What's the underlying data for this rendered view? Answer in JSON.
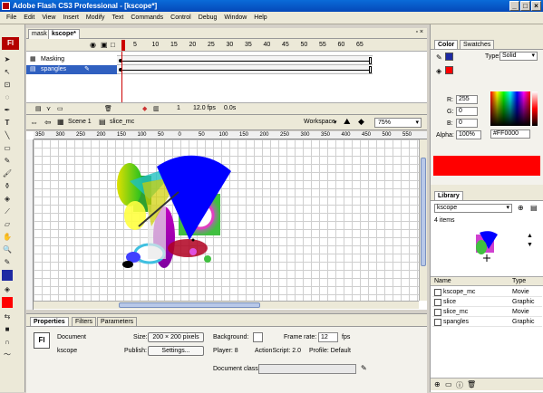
{
  "window": {
    "title": "Adobe Flash CS3 Professional - [kscope*]"
  },
  "menu": [
    "File",
    "Edit",
    "View",
    "Insert",
    "Modify",
    "Text",
    "Commands",
    "Control",
    "Debug",
    "Window",
    "Help"
  ],
  "tabs": [
    "mask",
    "kscope*"
  ],
  "timeline": {
    "frames": [
      "5",
      "10",
      "15",
      "20",
      "25",
      "30",
      "35",
      "40",
      "45",
      "50",
      "55",
      "60",
      "65"
    ],
    "layers": [
      {
        "name": "Masking"
      },
      {
        "name": "spangles"
      }
    ],
    "status": {
      "frame": "1",
      "fps": "12.0 fps",
      "time": "0.0s"
    }
  },
  "editbar": {
    "scene": "Scene 1",
    "symbol": "slice_mc",
    "workspace": "Workspace",
    "zoom": "75%"
  },
  "ruler": {
    "h": [
      "350",
      "300",
      "250",
      "200",
      "150",
      "100",
      "50",
      "0",
      "50",
      "100",
      "150",
      "200",
      "250",
      "300",
      "350",
      "400",
      "450",
      "500",
      "550"
    ]
  },
  "properties": {
    "tabs": [
      "Properties",
      "Filters",
      "Parameters"
    ],
    "doc_label": "Document",
    "doc_name": "kscope",
    "size_label": "Size:",
    "size_value": "200 × 200 pixels",
    "background_label": "Background:",
    "framerate_label": "Frame rate:",
    "framerate_value": "12",
    "fps": "fps",
    "publish_label": "Publish:",
    "settings": "Settings...",
    "player": "Player:  8",
    "actionscript": "ActionScript:  2.0",
    "profile": "Profile:  Default",
    "docclass_label": "Document class:"
  },
  "color_panel": {
    "tabs": [
      "Color",
      "Swatches"
    ],
    "type_label": "Type:",
    "type_value": "Solid",
    "r_label": "R:",
    "r": "255",
    "g_label": "G:",
    "g": "0",
    "b_label": "B:",
    "b": "0",
    "alpha_label": "Alpha:",
    "alpha": "100%",
    "hex": "#FF0000",
    "color": "#ff0000"
  },
  "library": {
    "tab": "Library",
    "doc": "kscope",
    "count": "4 items",
    "col_name": "Name",
    "col_type": "Type",
    "items": [
      {
        "name": "kscope_mc",
        "type": "Movie"
      },
      {
        "name": "slice",
        "type": "Graphic"
      },
      {
        "name": "slice_mc",
        "type": "Movie"
      },
      {
        "name": "spangles",
        "type": "Graphic"
      }
    ]
  }
}
